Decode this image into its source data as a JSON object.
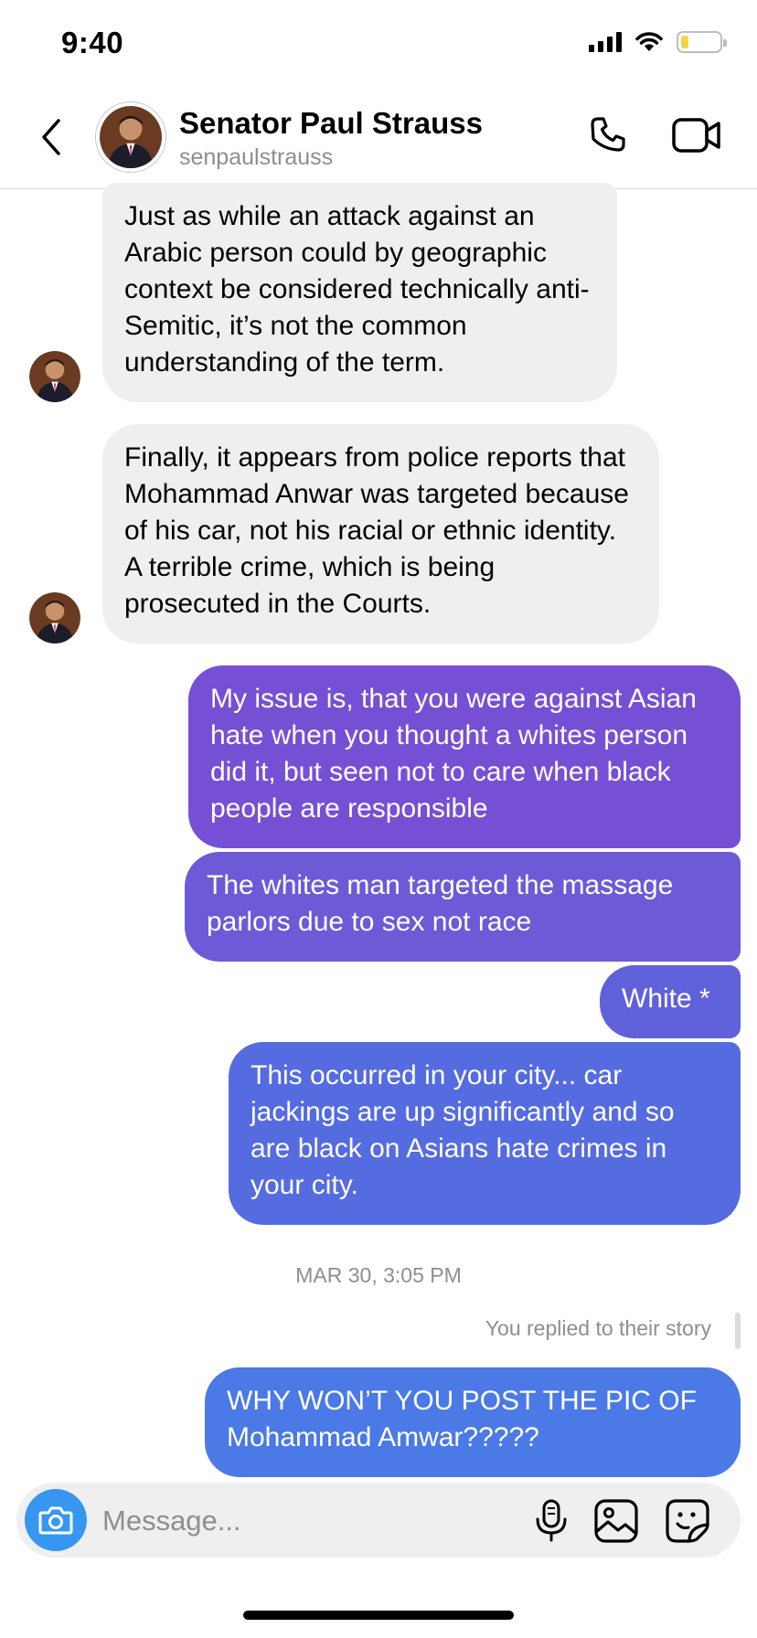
{
  "status_bar": {
    "time": "9:40",
    "signal_icon": "cellular-signal-icon",
    "wifi_icon": "wifi-icon",
    "battery_icon": "battery-icon",
    "battery_level": 0.2
  },
  "header": {
    "back_icon": "chevron-left-icon",
    "name": "Senator Paul Strauss",
    "username": "senpaulstrauss",
    "call_icon": "phone-icon",
    "video_icon": "video-camera-icon"
  },
  "messages": [
    {
      "from": "them",
      "text": "Just as while an attack against an Arabic person could by geographic context be considered technically anti-Semitic, it’s not the common understanding of the term."
    },
    {
      "from": "them",
      "text": "Finally, it appears from police reports that Mohammad Anwar was targeted because of his car, not his racial or ethnic identity.  A terrible crime, which is being prosecuted in the Courts."
    },
    {
      "from": "me",
      "text": "My issue is, that you were against Asian hate when you thought a whites person did it, but seen not to care when black people are responsible"
    },
    {
      "from": "me",
      "text": "The whites man targeted the massage parlors due to sex not race"
    },
    {
      "from": "me",
      "text": "White *"
    },
    {
      "from": "me",
      "text": "This occurred in your city... car jackings are up significantly and so are black on Asians hate crimes in your city."
    },
    {
      "from": "me",
      "text": "WHY WON’T YOU POST THE PIC OF Mohammad Amwar?????"
    }
  ],
  "timestamp": "MAR 30, 3:05 PM",
  "story_reply_note": "You replied to their story",
  "composer": {
    "placeholder": "Message...",
    "camera_icon": "camera-icon",
    "mic_icon": "microphone-icon",
    "gallery_icon": "image-gallery-icon",
    "sticker_icon": "sticker-icon"
  },
  "colors": {
    "accent_blue": "#3797f0",
    "outgoing_gradient_top": "#7b4fd6",
    "outgoing_gradient_bottom": "#3f7be8",
    "incoming_bubble": "#efefef"
  }
}
